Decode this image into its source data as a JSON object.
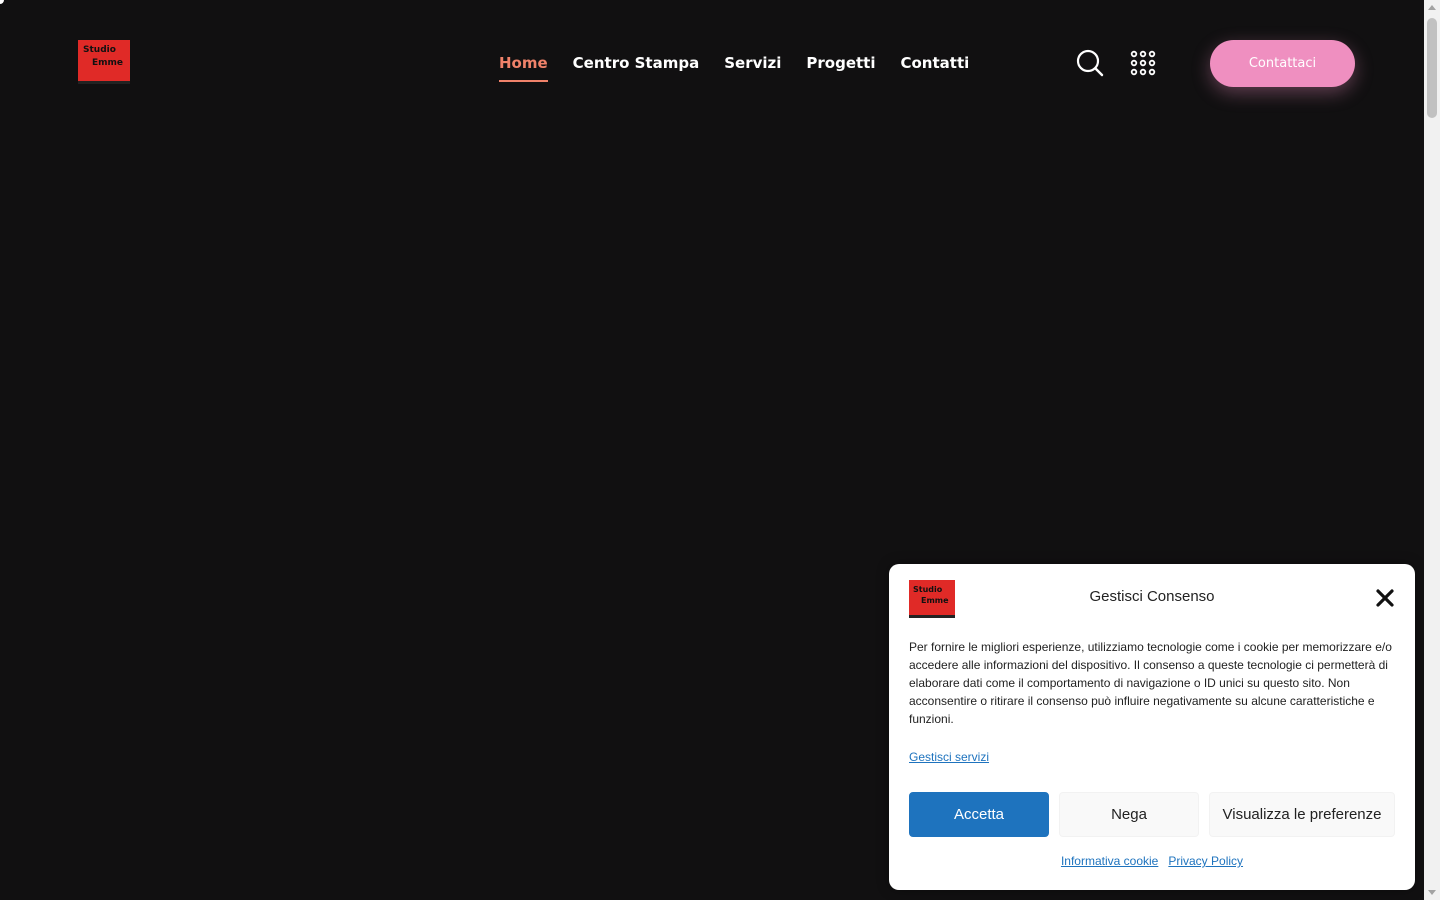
{
  "brand": {
    "logo_line1": "Studio",
    "logo_line2": "Emme",
    "colors": {
      "background": "#111011",
      "logo_red": "#e02a27",
      "nav_active": "#f0826a",
      "cta": "#ef8fc0",
      "accept_blue": "#1e73be"
    }
  },
  "nav": {
    "items": [
      {
        "label": "Home",
        "active": true
      },
      {
        "label": "Centro Stampa",
        "active": false
      },
      {
        "label": "Servizi",
        "active": false
      },
      {
        "label": "Progetti",
        "active": false
      },
      {
        "label": "Contatti",
        "active": false
      }
    ]
  },
  "header": {
    "search_icon": "search-icon",
    "apps_icon": "grid-dots-icon",
    "cta_label": "Contattaci"
  },
  "consent": {
    "title": "Gestisci Consenso",
    "close_icon": "close-icon",
    "body": "Per fornire le migliori esperienze, utilizziamo tecnologie come i cookie per memorizzare e/o accedere alle informazioni del dispositivo. Il consenso a queste tecnologie ci permetterà di elaborare dati come il comportamento di navigazione o ID unici su questo sito. Non acconsentire o ritirare il consenso può influire negativamente su alcune caratteristiche e funzioni.",
    "manage_link": "Gestisci servizi",
    "accept_label": "Accetta",
    "deny_label": "Nega",
    "prefs_label": "Visualizza le preferenze",
    "links": [
      "Informativa cookie",
      "Privacy Policy"
    ]
  }
}
